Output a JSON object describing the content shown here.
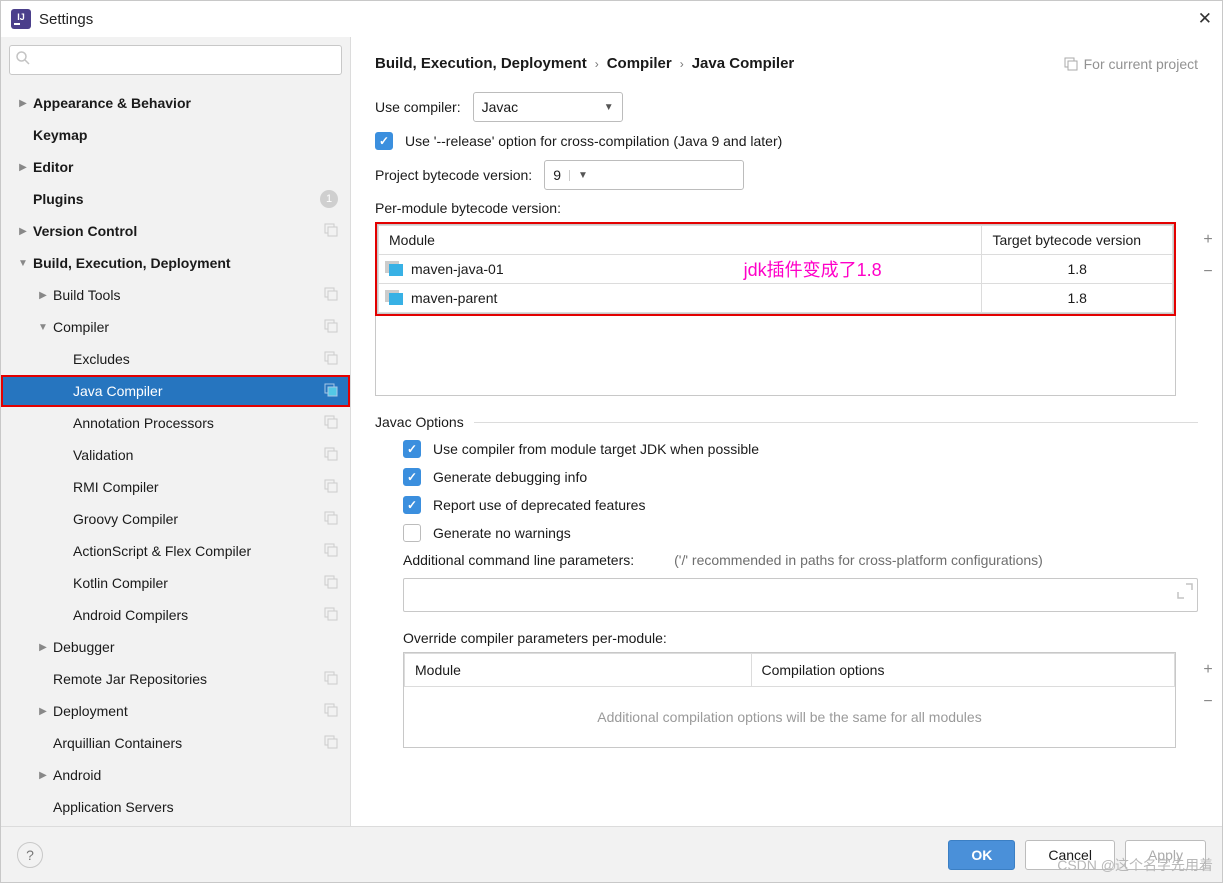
{
  "window": {
    "title": "Settings"
  },
  "search": {
    "placeholder": ""
  },
  "tree": [
    {
      "label": "Appearance & Behavior",
      "level": 0,
      "arrow": "▶",
      "bold": true
    },
    {
      "label": "Keymap",
      "level": 0,
      "bold": true
    },
    {
      "label": "Editor",
      "level": 0,
      "arrow": "▶",
      "bold": true
    },
    {
      "label": "Plugins",
      "level": 0,
      "bold": true,
      "badge": "1"
    },
    {
      "label": "Version Control",
      "level": 0,
      "arrow": "▶",
      "bold": true,
      "copy": true
    },
    {
      "label": "Build, Execution, Deployment",
      "level": 0,
      "arrow": "▼",
      "bold": true
    },
    {
      "label": "Build Tools",
      "level": 1,
      "arrow": "▶",
      "copy": true
    },
    {
      "label": "Compiler",
      "level": 1,
      "arrow": "▼",
      "copy": true
    },
    {
      "label": "Excludes",
      "level": 2,
      "copy": true
    },
    {
      "label": "Java Compiler",
      "level": 2,
      "copy": true,
      "selected": true,
      "highlighted": true
    },
    {
      "label": "Annotation Processors",
      "level": 2,
      "copy": true
    },
    {
      "label": "Validation",
      "level": 2,
      "copy": true
    },
    {
      "label": "RMI Compiler",
      "level": 2,
      "copy": true
    },
    {
      "label": "Groovy Compiler",
      "level": 2,
      "copy": true
    },
    {
      "label": "ActionScript & Flex Compiler",
      "level": 2,
      "copy": true
    },
    {
      "label": "Kotlin Compiler",
      "level": 2,
      "copy": true
    },
    {
      "label": "Android Compilers",
      "level": 2,
      "copy": true
    },
    {
      "label": "Debugger",
      "level": 1,
      "arrow": "▶"
    },
    {
      "label": "Remote Jar Repositories",
      "level": 1,
      "copy": true
    },
    {
      "label": "Deployment",
      "level": 1,
      "arrow": "▶",
      "copy": true
    },
    {
      "label": "Arquillian Containers",
      "level": 1,
      "copy": true
    },
    {
      "label": "Android",
      "level": 1,
      "arrow": "▶"
    },
    {
      "label": "Application Servers",
      "level": 1
    }
  ],
  "breadcrumb": [
    "Build, Execution, Deployment",
    "Compiler",
    "Java Compiler"
  ],
  "for_project": "For current project",
  "compiler": {
    "use_label": "Use compiler:",
    "use_value": "Javac",
    "release_opt": "Use '--release' option for cross-compilation (Java 9 and later)",
    "bytecode_label": "Project bytecode version:",
    "bytecode_value": "9",
    "permod_label": "Per-module bytecode version:"
  },
  "module_table": {
    "headers": [
      "Module",
      "Target bytecode version"
    ],
    "rows": [
      {
        "name": "maven-java-01",
        "ver": "1.8"
      },
      {
        "name": "maven-parent",
        "ver": "1.8"
      }
    ],
    "annotation": "jdk插件变成了1.8"
  },
  "javac": {
    "title": "Javac Options",
    "opt1": "Use compiler from module target JDK when possible",
    "opt2": "Generate debugging info",
    "opt3": "Report use of deprecated features",
    "opt4": "Generate no warnings",
    "params_label": "Additional command line parameters:",
    "params_hint": "('/' recommended in paths for cross-platform configurations)",
    "override_label": "Override compiler parameters per-module:",
    "override_headers": [
      "Module",
      "Compilation options"
    ],
    "override_placeholder": "Additional compilation options will be the same for all modules"
  },
  "footer": {
    "ok": "OK",
    "cancel": "Cancel",
    "apply": "Apply"
  },
  "watermark": "CSDN @这个名字先用着"
}
